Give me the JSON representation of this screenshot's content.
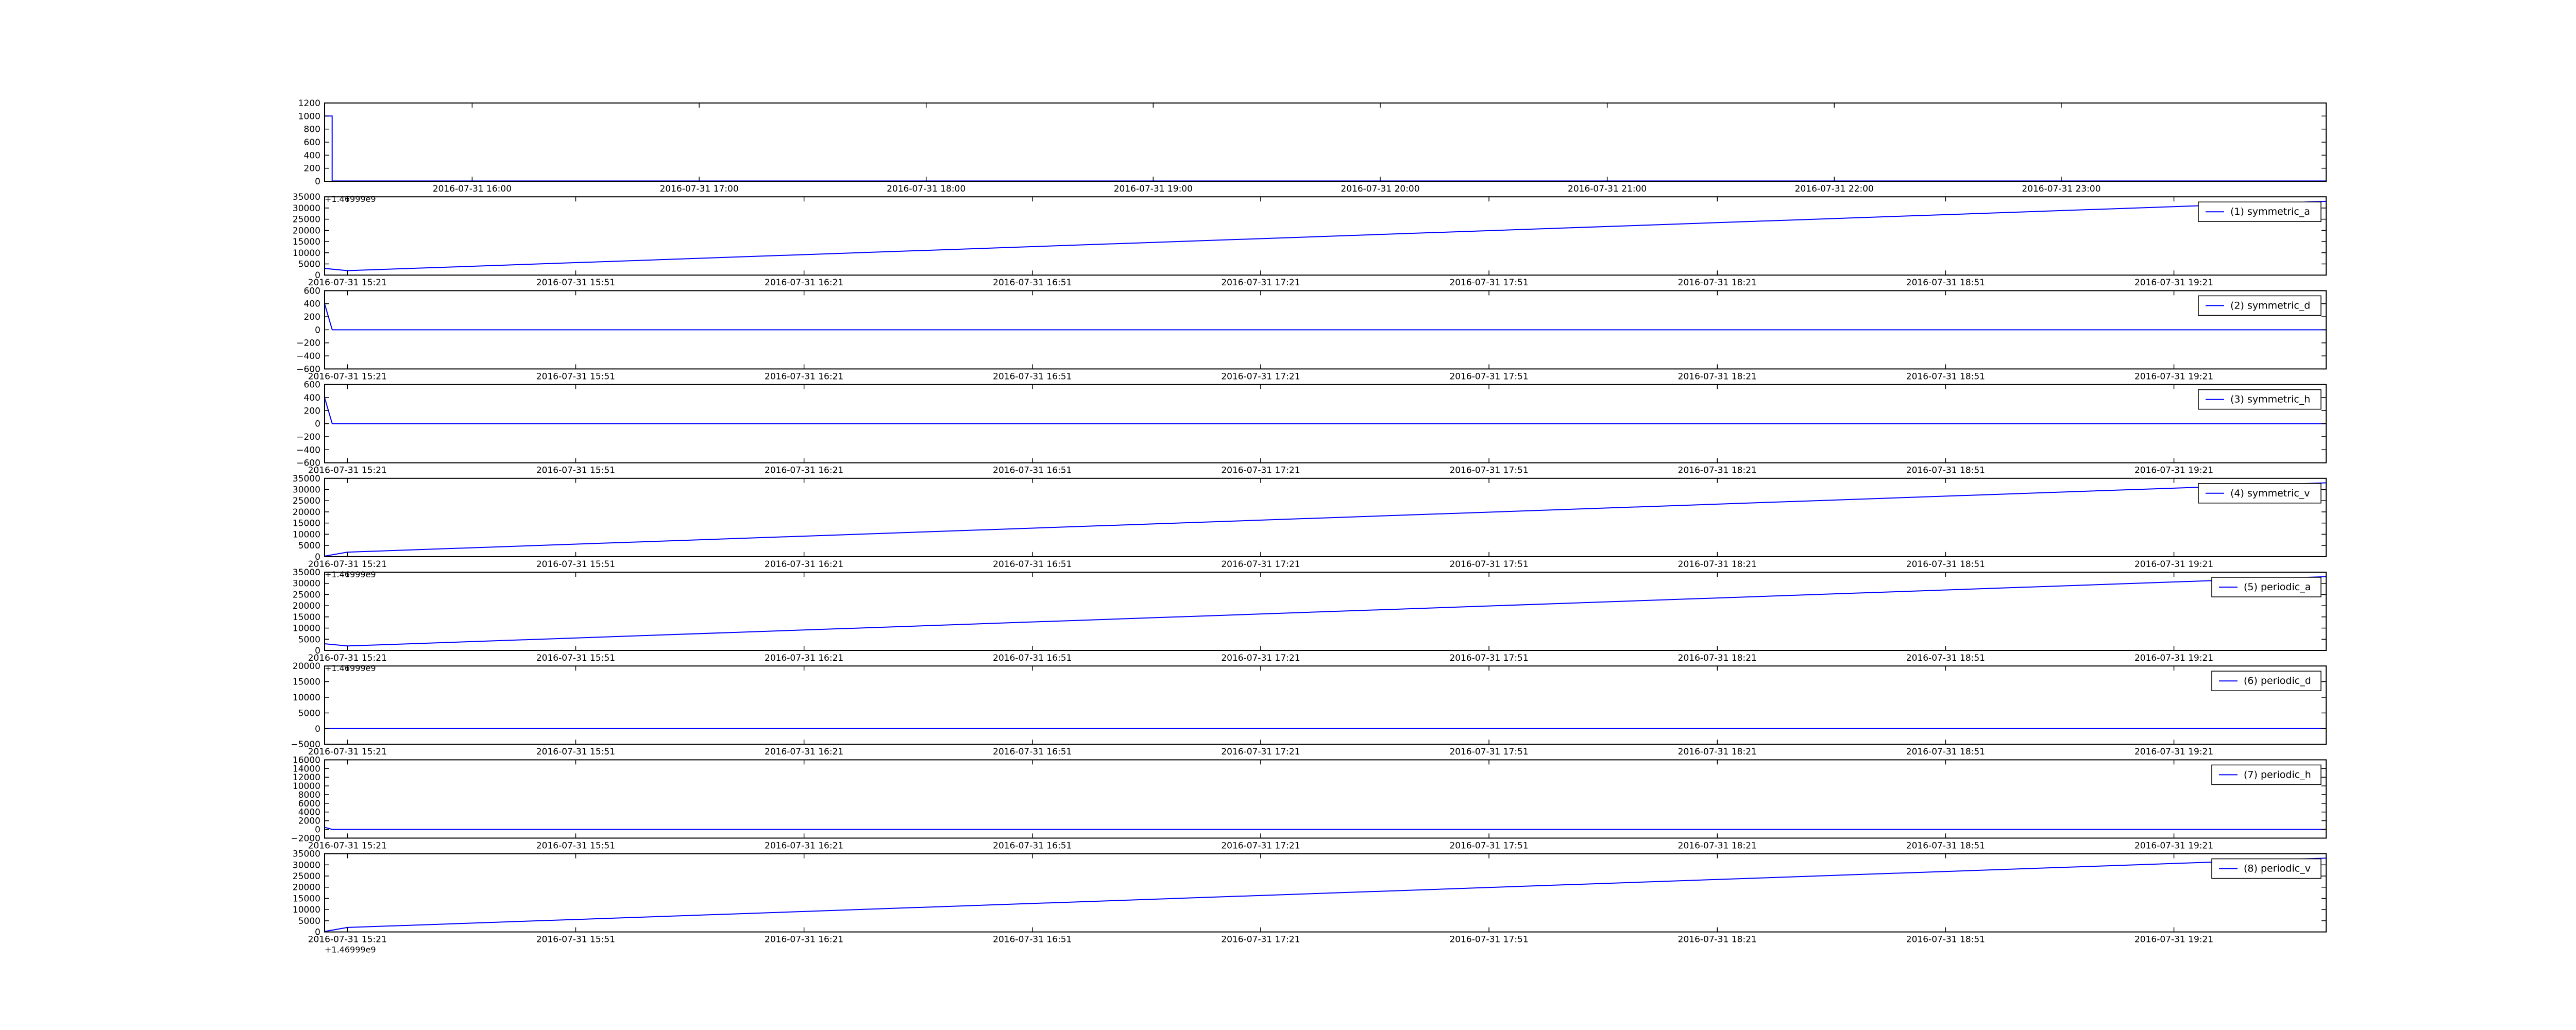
{
  "colors": {
    "line": "#0000ff",
    "axes": "#000000",
    "background": "#ffffff"
  },
  "x_tick_labels": [
    "2016-07-31 15:21",
    "2016-07-31 15:51",
    "2016-07-31 16:21",
    "2016-07-31 16:51",
    "2016-07-31 17:21",
    "2016-07-31 17:51",
    "2016-07-31 18:21",
    "2016-07-31 18:51",
    "2016-07-31 19:21"
  ],
  "chart_data": [
    {
      "type": "line",
      "title": "",
      "legend": "",
      "offset_label": "+1.46999e9",
      "ylim": [
        0,
        1200
      ],
      "yticks": [
        "0",
        "200",
        "400",
        "600",
        "800",
        "1000",
        "1200"
      ],
      "x_tick_labels": [
        "2016-07-31 16:00",
        "2016-07-31 17:00",
        "2016-07-31 18:00",
        "2016-07-31 19:00",
        "2016-07-31 20:00",
        "2016-07-31 21:00",
        "2016-07-31 22:00",
        "2016-07-31 23:00"
      ],
      "xlim": [
        "2016-07-31 15:21",
        "2016-08-01 00:10"
      ],
      "series": [
        {
          "x": [
            "2016-07-31 15:21",
            "2016-07-31 15:21",
            "2016-07-31 15:23",
            "2016-07-31 15:23",
            "2016-08-01 00:10"
          ],
          "values": [
            0,
            1000,
            1000,
            5,
            5
          ]
        }
      ]
    },
    {
      "type": "line",
      "legend": "(1) symmetric_a",
      "offset_label": "",
      "ylim": [
        0,
        35000
      ],
      "yticks": [
        "0",
        "5000",
        "10000",
        "15000",
        "20000",
        "25000",
        "30000",
        "35000"
      ],
      "xlim": [
        "2016-07-31 15:18",
        "2016-07-31 19:41"
      ],
      "series": [
        {
          "name": "(1) symmetric_a",
          "x": [
            "2016-07-31 15:18",
            "2016-07-31 15:21",
            "2016-07-31 19:41"
          ],
          "values": [
            3000,
            2000,
            33000
          ]
        }
      ]
    },
    {
      "type": "line",
      "legend": "(2) symmetric_d",
      "offset_label": "",
      "ylim": [
        -600,
        600
      ],
      "yticks": [
        "−600",
        "−400",
        "−200",
        "0",
        "200",
        "400",
        "600"
      ],
      "xlim": [
        "2016-07-31 15:18",
        "2016-07-31 19:41"
      ],
      "series": [
        {
          "name": "(2) symmetric_d",
          "x": [
            "2016-07-31 15:18",
            "2016-07-31 15:18",
            "2016-07-31 15:18",
            "2016-07-31 15:19",
            "2016-07-31 19:41"
          ],
          "values": [
            500,
            -500,
            400,
            0,
            0
          ]
        }
      ]
    },
    {
      "type": "line",
      "legend": "(3) symmetric_h",
      "offset_label": "",
      "ylim": [
        -600,
        600
      ],
      "yticks": [
        "−600",
        "−400",
        "−200",
        "0",
        "200",
        "400",
        "600"
      ],
      "xlim": [
        "2016-07-31 15:18",
        "2016-07-31 19:41"
      ],
      "series": [
        {
          "name": "(3) symmetric_h",
          "x": [
            "2016-07-31 15:18",
            "2016-07-31 15:18",
            "2016-07-31 15:18",
            "2016-07-31 15:19",
            "2016-07-31 19:41"
          ],
          "values": [
            450,
            -450,
            400,
            0,
            0
          ]
        }
      ]
    },
    {
      "type": "line",
      "legend": "(4) symmetric_v",
      "offset_label": "+1.46999e9",
      "ylim": [
        0,
        35000
      ],
      "yticks": [
        "0",
        "5000",
        "10000",
        "15000",
        "20000",
        "25000",
        "30000",
        "35000"
      ],
      "xlim": [
        "2016-07-31 15:18",
        "2016-07-31 19:41"
      ],
      "series": [
        {
          "name": "(4) symmetric_v",
          "x": [
            "2016-07-31 15:18",
            "2016-07-31 15:21",
            "2016-07-31 19:41"
          ],
          "values": [
            200,
            2000,
            33000
          ]
        }
      ]
    },
    {
      "type": "line",
      "legend": "(5) periodic_a",
      "offset_label": "+1.46999e9",
      "ylim": [
        0,
        35000
      ],
      "yticks": [
        "0",
        "5000",
        "10000",
        "15000",
        "20000",
        "25000",
        "30000",
        "35000"
      ],
      "xlim": [
        "2016-07-31 15:18",
        "2016-07-31 19:41"
      ],
      "series": [
        {
          "name": "(5) periodic_a",
          "x": [
            "2016-07-31 15:18",
            "2016-07-31 15:21",
            "2016-07-31 19:41"
          ],
          "values": [
            3000,
            2000,
            33000
          ]
        }
      ]
    },
    {
      "type": "line",
      "legend": "(6) periodic_d",
      "offset_label": "",
      "ylim": [
        -5000,
        20000
      ],
      "yticks": [
        "−5000",
        "0",
        "5000",
        "10000",
        "15000",
        "20000"
      ],
      "xlim": [
        "2016-07-31 15:18",
        "2016-07-31 19:41"
      ],
      "series": [
        {
          "name": "(6) periodic_d",
          "x": [
            "2016-07-31 15:18",
            "2016-07-31 19:41"
          ],
          "values": [
            0,
            0
          ]
        }
      ]
    },
    {
      "type": "line",
      "legend": "(7) periodic_h",
      "offset_label": "",
      "ylim": [
        -2000,
        16000
      ],
      "yticks": [
        "−2000",
        "0",
        "2000",
        "4000",
        "6000",
        "8000",
        "10000",
        "12000",
        "14000",
        "16000"
      ],
      "xlim": [
        "2016-07-31 15:18",
        "2016-07-31 19:41"
      ],
      "series": [
        {
          "name": "(7) periodic_h",
          "x": [
            "2016-07-31 15:18",
            "2016-07-31 15:19",
            "2016-07-31 19:41"
          ],
          "values": [
            500,
            0,
            0
          ]
        }
      ]
    },
    {
      "type": "line",
      "legend": "(8) periodic_v",
      "offset_label": "+1.46999e9",
      "ylim": [
        0,
        35000
      ],
      "yticks": [
        "0",
        "5000",
        "10000",
        "15000",
        "20000",
        "25000",
        "30000",
        "35000"
      ],
      "xlim": [
        "2016-07-31 15:18",
        "2016-07-31 19:41"
      ],
      "series": [
        {
          "name": "(8) periodic_v",
          "x": [
            "2016-07-31 15:18",
            "2016-07-31 15:21",
            "2016-07-31 19:41"
          ],
          "values": [
            200,
            2000,
            33000
          ]
        }
      ]
    }
  ]
}
